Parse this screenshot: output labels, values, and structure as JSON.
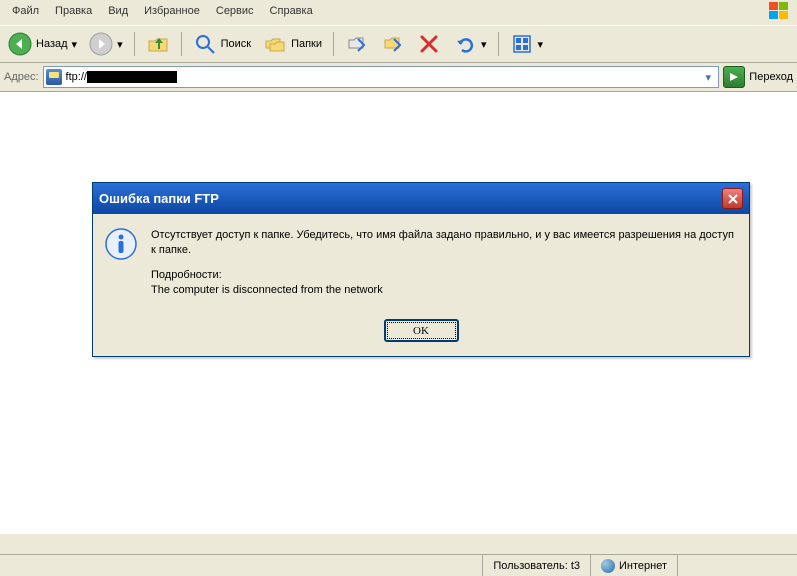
{
  "menu": {
    "items": [
      "Файл",
      "Правка",
      "Вид",
      "Избранное",
      "Сервис",
      "Справка"
    ]
  },
  "toolbar": {
    "back": "Назад",
    "search": "Поиск",
    "folders": "Папки"
  },
  "address": {
    "label": "Адрес:",
    "prefix": "ftp://",
    "go": "Переход"
  },
  "dialog": {
    "title": "Ошибка папки FTP",
    "line1": "Отсутствует доступ к папке. Убедитесь, что имя файла задано правильно, и у вас имеется разрешения на доступ к папке.",
    "details_label": "Подробности:",
    "details": "The computer is disconnected from the network",
    "ok": "OK"
  },
  "status": {
    "user": "Пользователь: t3",
    "zone": "Интернет"
  }
}
